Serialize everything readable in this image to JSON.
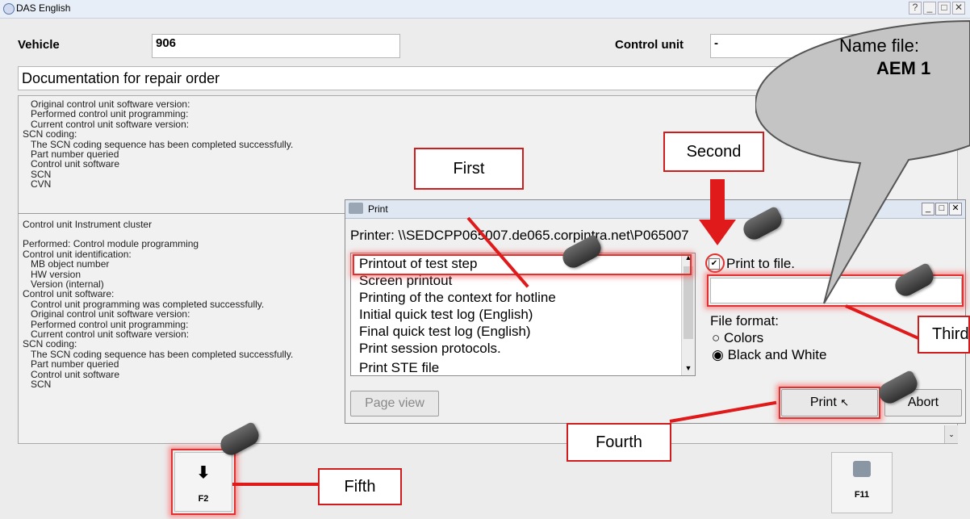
{
  "window": {
    "title": "DAS English"
  },
  "header": {
    "vehicle_label": "Vehicle",
    "vehicle_value": "906",
    "control_unit_label": "Control unit",
    "control_unit_value": "-",
    "doc_title": "Documentation for repair order"
  },
  "doc_lines_top": [
    "Original control unit software version:",
    "Performed control unit programming:",
    "Current control unit software version:",
    "SCN coding:",
    "  The SCN coding sequence has been completed successfully.",
    "  Part number queried",
    "  Control unit software",
    "  SCN",
    "  CVN"
  ],
  "doc_lines_bottom": [
    "Control unit Instrument cluster",
    "",
    "Performed: Control module programming",
    "Control unit identification:",
    "  MB object number",
    "  HW version",
    "  Version (internal)",
    "Control unit software:",
    "  Control unit programming was completed successfully.",
    "  Original control unit software version:",
    "  Performed control unit programming:",
    "  Current control unit software version:",
    "SCN coding:",
    "  The SCN coding sequence has been completed successfully.",
    "  Part number queried",
    "  Control unit software",
    "  SCN"
  ],
  "dialog": {
    "title": "Print",
    "printer_text": "Printer: \\\\SEDCPP065007.de065.corpintra.net\\P065007",
    "list_items": [
      "Printout of test step",
      "Screen printout",
      "Printing of the context for hotline",
      "Initial quick test log (English)",
      "Final quick test log (English)",
      "Print session protocols.",
      "Print STE file"
    ],
    "print_to_file_label": "Print to file.",
    "print_to_file_checked": true,
    "file_name_value": "",
    "file_format_label": "File format:",
    "format_options": [
      "Colors",
      "Black and White"
    ],
    "format_selected": "Black and White",
    "page_view_label": "Page view",
    "print_label": "Print",
    "abort_label": "Abort"
  },
  "callouts": {
    "first": "First",
    "second": "Second",
    "third": "Third",
    "fourth": "Fourth",
    "fifth": "Fifth",
    "bubble_line1": "Name file:",
    "bubble_line2": "AEM 1"
  },
  "fkeys": {
    "f2": "F2",
    "f11": "F11"
  },
  "colors": {
    "highlight_red": "#e01a1a",
    "titlebar": "#e8eef7"
  }
}
